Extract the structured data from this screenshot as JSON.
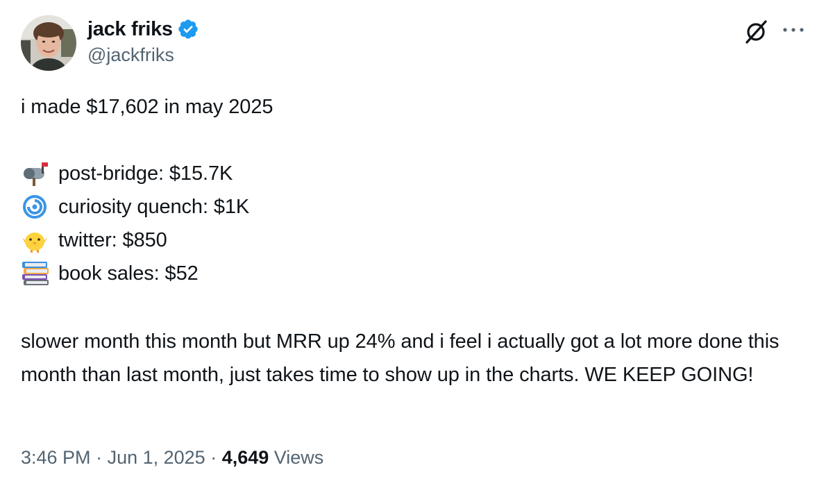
{
  "author": {
    "display_name": "jack friks",
    "handle": "@jackfriks",
    "verified": true,
    "avatar_icon": "profile-photo"
  },
  "header_actions": {
    "grok_icon": "grok-slash-circle-icon",
    "more_icon": "more-dots-icon"
  },
  "tweet": {
    "intro": "i made $17,602 in may 2025",
    "income": [
      {
        "icon": "mailbox-emoji",
        "label": "post-bridge:  $15.7K"
      },
      {
        "icon": "cyclone-emoji",
        "label": "curiosity quench: $1K"
      },
      {
        "icon": "baby-chick-emoji",
        "label": "twitter: $850"
      },
      {
        "icon": "books-emoji",
        "label": "book sales: $52"
      }
    ],
    "outro": "slower month this month but MRR up 24% and i feel i actually got a lot more done this month than last month, just takes time to show up in the charts. WE KEEP GOING!"
  },
  "meta": {
    "time": "3:46 PM",
    "separator": " · ",
    "date": "Jun 1, 2025",
    "views_count": "4,649",
    "views_label": " Views"
  },
  "colors": {
    "text": "#0f1419",
    "secondary": "#536471",
    "verified_blue": "#1d9bf0"
  }
}
